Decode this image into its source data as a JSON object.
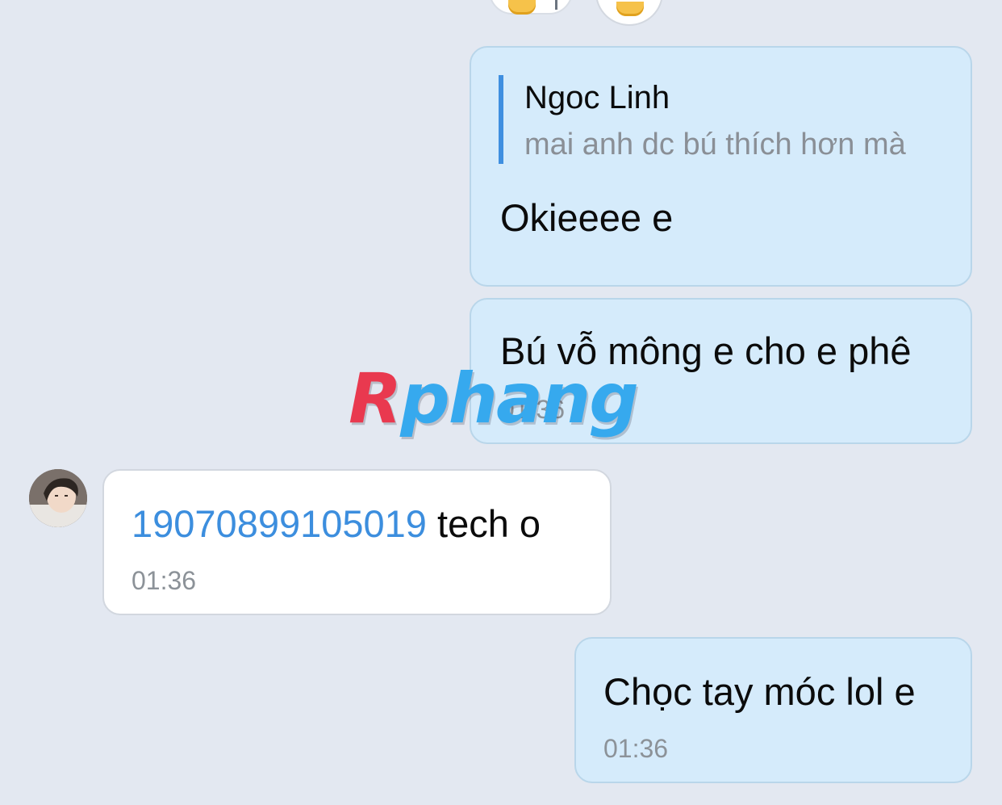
{
  "messages": [
    {
      "direction": "outgoing",
      "quote": {
        "author": "Ngoc Linh",
        "text": "mai anh dc bú thích hơn mà"
      },
      "text": "Okieeee e"
    },
    {
      "direction": "outgoing",
      "text": "Bú vỗ mông e cho e phê",
      "time": "01:36"
    },
    {
      "direction": "incoming",
      "link": "19070899105019",
      "text": " tech o",
      "time": "01:36"
    },
    {
      "direction": "outgoing",
      "text": "Chọc tay móc lol e",
      "time": "01:36"
    }
  ],
  "watermark": {
    "first": "R",
    "rest": "phang"
  },
  "icons": {
    "reaction": "thumbs-up-icon",
    "avatar": "contact-avatar"
  },
  "colors": {
    "background": "#e3e8f1",
    "outgoing_bubble": "#d5ebfb",
    "incoming_bubble": "#ffffff",
    "link": "#3c8ede",
    "quote_bar": "#3f8fe0",
    "time": "#8c9298"
  }
}
